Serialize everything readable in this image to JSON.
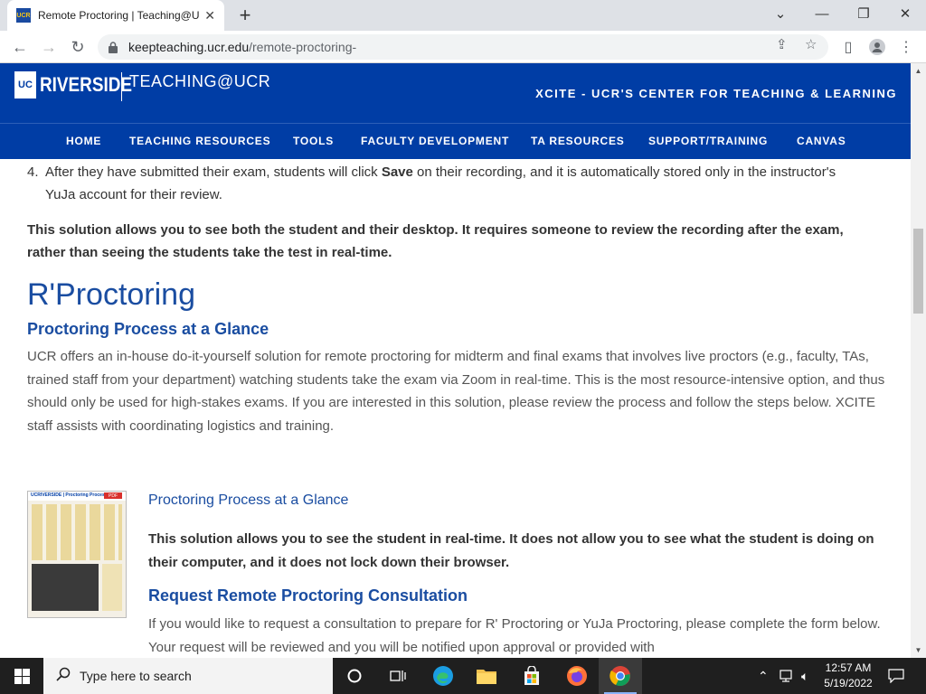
{
  "browser": {
    "tab_title": "Remote Proctoring | Teaching@UCR",
    "favicon_text": "UCR",
    "url_host": "keepteaching.ucr.edu",
    "url_path": "/remote-proctoring-"
  },
  "site": {
    "logo_uc": "UC",
    "logo_name": "RIVERSIDE",
    "title": "TEACHING@UCR",
    "tagline": "XCITE - UCR'S CENTER FOR TEACHING & LEARNING",
    "nav": [
      "HOME",
      "TEACHING RESOURCES",
      "TOOLS",
      "FACULTY DEVELOPMENT",
      "TA RESOURCES",
      "SUPPORT/TRAINING",
      "CANVAS"
    ]
  },
  "content": {
    "step4_number": "4.",
    "step4_pre": "After they have submitted their exam, students will click ",
    "step4_bold": "Save",
    "step4_post": " on their recording, and it is automatically stored only in the instructor's YuJa account for their review.",
    "yuja_summary": "This solution allows you to see both the student and their desktop. It requires someone to review the recording after the exam, rather than seeing the students take the test in real-time.",
    "rproctoring_heading": "R'Proctoring",
    "process_heading": "Proctoring Process at a Glance",
    "rproctoring_intro": "UCR offers an in-house do-it-yourself solution for remote proctoring for midterm and final exams that involves live proctors (e.g., faculty, TAs, trained staff from your department) watching students take the exam via Zoom in real-time. This is the most resource-intensive option, and thus should only be used for high-stakes exams. If you are interested in this solution, please review the process and follow the steps below. XCITE staff assists with coordinating logistics and training.",
    "thumb_logo": "UCRIVERSIDE",
    "thumb_title": "Proctoring Process",
    "thumb_pdf": "PDF",
    "process_link": "Proctoring Process at a Glance",
    "rproctoring_summary": "This solution allows you to see the student in real-time. It does not allow you to see what the student is doing on their computer, and it does not lock down their browser.",
    "consult_heading": "Request Remote Proctoring Consultation",
    "consult_text": "If you would like to request a consultation to prepare for R' Proctoring or YuJa Proctoring, please complete the form below. Your request will be reviewed and you will be notified upon approval or provided with"
  },
  "taskbar": {
    "search_placeholder": "Type here to search",
    "time": "12:57 AM",
    "date": "5/19/2022"
  }
}
